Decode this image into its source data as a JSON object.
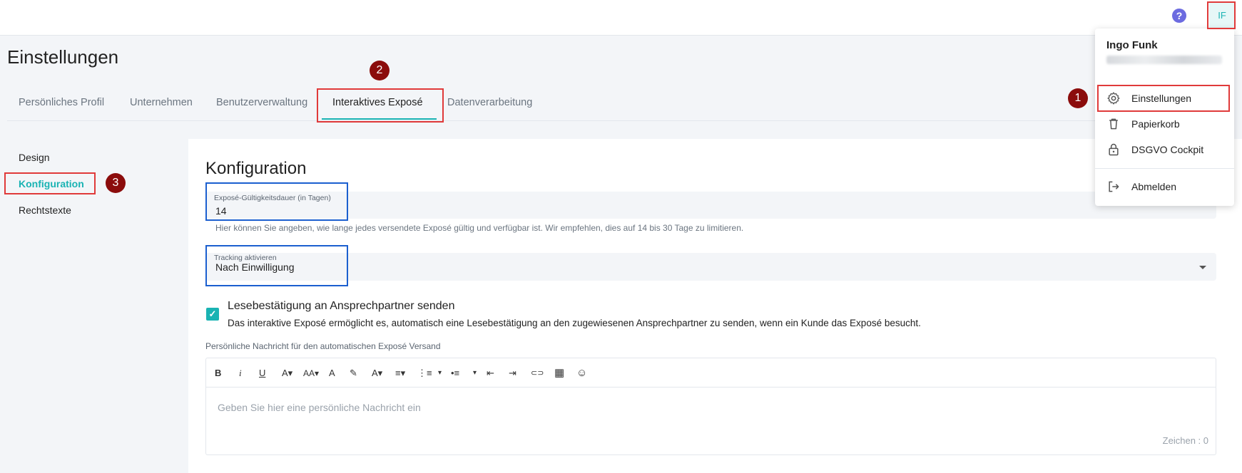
{
  "header": {
    "help_icon_glyph": "?",
    "avatar_initials": "IF"
  },
  "page": {
    "title": "Einstellungen"
  },
  "tabs": [
    {
      "label": "Persönliches Profil"
    },
    {
      "label": "Unternehmen"
    },
    {
      "label": "Benutzerverwaltung"
    },
    {
      "label": "Interaktives Exposé",
      "active": true
    },
    {
      "label": "Datenverarbeitung"
    }
  ],
  "sidebar": {
    "items": [
      {
        "label": "Design"
      },
      {
        "label": "Konfiguration",
        "active": true
      },
      {
        "label": "Rechtstexte"
      }
    ]
  },
  "main": {
    "section_title": "Konfiguration",
    "validity": {
      "label": "Exposé-Gültigkeitsdauer (in Tagen)",
      "value": "14",
      "hint": "Hier können Sie angeben, wie lange jedes versendete Exposé gültig und verfügbar ist. Wir empfehlen, dies auf 14 bis 30 Tage zu limitieren."
    },
    "tracking": {
      "label": "Tracking aktivieren",
      "selected": "Nach Einwilligung"
    },
    "read_receipt": {
      "checked": true,
      "title": "Lesebestätigung an Ansprechpartner senden",
      "description": "Das interaktive Exposé ermöglicht es, automatisch eine Lesebestätigung an den zugewiesenen Ansprechpartner zu senden, wenn ein Kunde das Exposé besucht."
    },
    "message_editor": {
      "label": "Persönliche Nachricht für den automatischen Exposé Versand",
      "placeholder": "Geben Sie hier eine persönliche Nachricht ein",
      "counter": "Zeichen : 0",
      "toolbar": {
        "bold": "B",
        "italic": "i",
        "underline": "U",
        "font_size": "A▾",
        "font_family": "AA▾",
        "text_color": "A",
        "highlight": "✎",
        "text_style": "A▾",
        "align": "≡▾",
        "ordered_list": "⋮≡",
        "ordered_caret": "▾",
        "unordered_list": "•≡",
        "unordered_caret": "▾",
        "outdent": "⇤",
        "indent": "⇥",
        "link": "⊂⊃",
        "table": "▦",
        "emoji": "☺"
      }
    }
  },
  "user_menu": {
    "name": "Ingo Funk",
    "items": [
      {
        "label": "Einstellungen",
        "icon": "gear-icon"
      },
      {
        "label": "Papierkorb",
        "icon": "trash-icon"
      },
      {
        "label": "DSGVO Cockpit",
        "icon": "lock-icon"
      },
      {
        "label": "Abmelden",
        "icon": "logout-icon"
      }
    ]
  },
  "annotations": {
    "badge_1": "1",
    "badge_2": "2",
    "badge_3": "3"
  },
  "colors": {
    "accent": "#1ab3b3",
    "highlight_red": "#e03a3a",
    "highlight_blue": "#1b5fcf",
    "badge": "#8b0c0c"
  }
}
